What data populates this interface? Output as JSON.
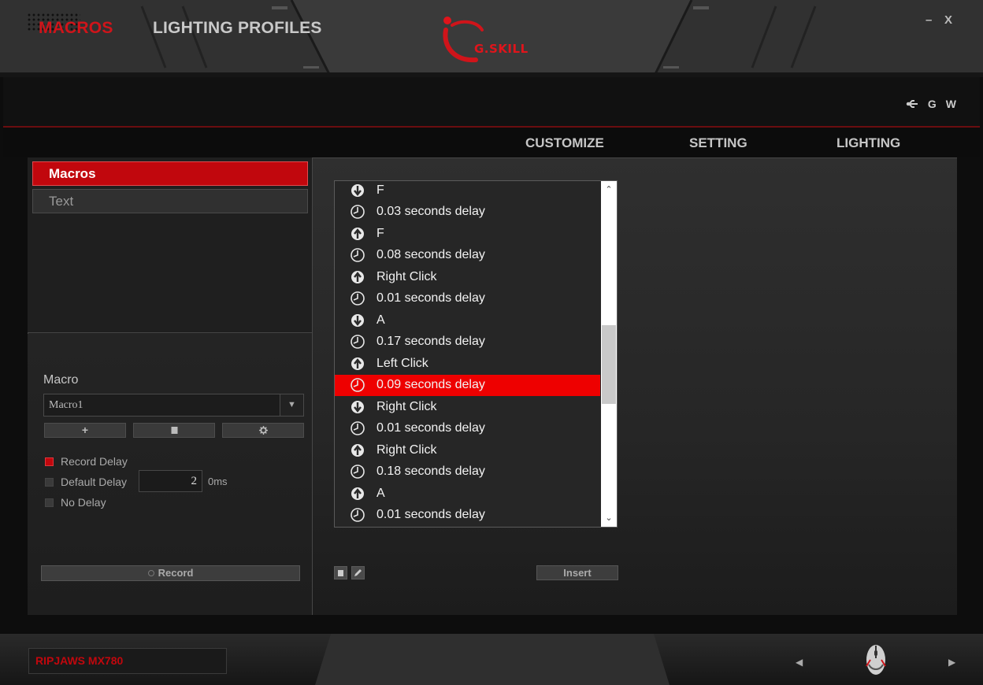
{
  "window": {
    "minimize": "–",
    "close": "X"
  },
  "nav": {
    "tabs": [
      {
        "label": "MACROS",
        "active": true
      },
      {
        "label": "LIGHTING PROFILES",
        "active": false
      }
    ],
    "right": {
      "g": "G",
      "w": "W"
    }
  },
  "subnav": [
    "CUSTOMIZE",
    "SETTING",
    "LIGHTING"
  ],
  "categories": [
    "Macros",
    "Text"
  ],
  "macro": {
    "label": "Macro",
    "selected": "Macro1",
    "options": {
      "record_delay": "Record Delay",
      "default_delay": "Default Delay",
      "no_delay": "No Delay",
      "default_delay_value": "2",
      "unit": "0ms"
    },
    "record": "Record"
  },
  "events": [
    {
      "icon": "key-down-icon",
      "text": "F"
    },
    {
      "icon": "clock-icon",
      "text": "0.03 seconds delay"
    },
    {
      "icon": "key-up-icon",
      "text": "F"
    },
    {
      "icon": "clock-icon",
      "text": "0.08 seconds delay"
    },
    {
      "icon": "key-up-icon",
      "text": "Right Click"
    },
    {
      "icon": "clock-icon",
      "text": "0.01 seconds delay"
    },
    {
      "icon": "key-down-icon",
      "text": "A"
    },
    {
      "icon": "clock-icon",
      "text": "0.17 seconds delay"
    },
    {
      "icon": "key-up-icon",
      "text": "Left Click"
    },
    {
      "icon": "clock-icon",
      "text": "0.09 seconds delay",
      "selected": true
    },
    {
      "icon": "key-down-icon",
      "text": "Right Click"
    },
    {
      "icon": "clock-icon",
      "text": "0.01 seconds delay"
    },
    {
      "icon": "key-up-icon",
      "text": "Right Click"
    },
    {
      "icon": "clock-icon",
      "text": "0.18 seconds delay"
    },
    {
      "icon": "key-up-icon",
      "text": "A"
    },
    {
      "icon": "clock-icon",
      "text": "0.01 seconds delay"
    }
  ],
  "editor": {
    "insert": "Insert"
  },
  "footer": {
    "device": "RIPJAWS MX780"
  },
  "colors": {
    "accent": "#c1070d",
    "selection": "#ee0000"
  }
}
